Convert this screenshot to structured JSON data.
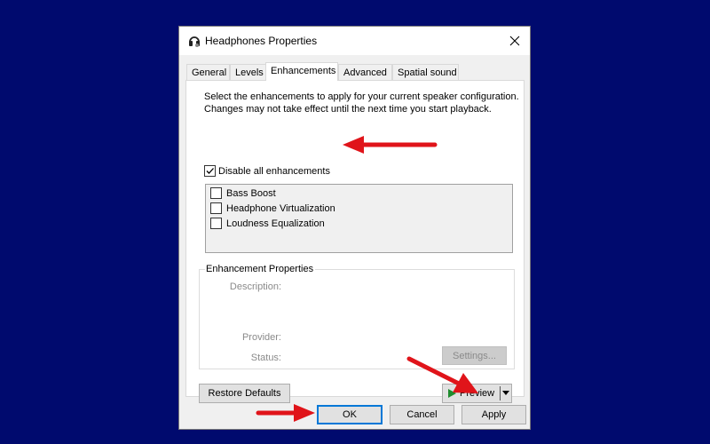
{
  "window": {
    "title": "Headphones Properties",
    "icon": "headphones-icon",
    "close_icon": "close-icon"
  },
  "tabs": [
    {
      "label": "General",
      "active": false
    },
    {
      "label": "Levels",
      "active": false
    },
    {
      "label": "Enhancements",
      "active": true
    },
    {
      "label": "Advanced",
      "active": false
    },
    {
      "label": "Spatial sound",
      "active": false
    }
  ],
  "enhancements": {
    "description": "Select the enhancements to apply for your current speaker configuration. Changes may not take effect until the next time you start playback.",
    "disable_all": {
      "label": "Disable all enhancements",
      "checked": true
    },
    "items": [
      {
        "label": "Bass Boost",
        "checked": false
      },
      {
        "label": "Headphone Virtualization",
        "checked": false
      },
      {
        "label": "Loudness Equalization",
        "checked": false
      }
    ],
    "properties": {
      "group_label": "Enhancement Properties",
      "description_label": "Description:",
      "provider_label": "Provider:",
      "status_label": "Status:",
      "settings_button": "Settings..."
    },
    "restore_defaults_button": "Restore Defaults",
    "preview_button": "Preview"
  },
  "footer": {
    "ok_button": "OK",
    "cancel_button": "Cancel",
    "apply_button": "Apply"
  },
  "annotations": {
    "arrow_color": "#e0141a",
    "arrows": [
      "points-to-disable-all-checkbox",
      "points-to-apply-button",
      "points-to-ok-button"
    ]
  },
  "colors": {
    "desktop_background": "#000a6e",
    "focus_border": "#0078d7",
    "preview_play": "#1e8c2e"
  }
}
